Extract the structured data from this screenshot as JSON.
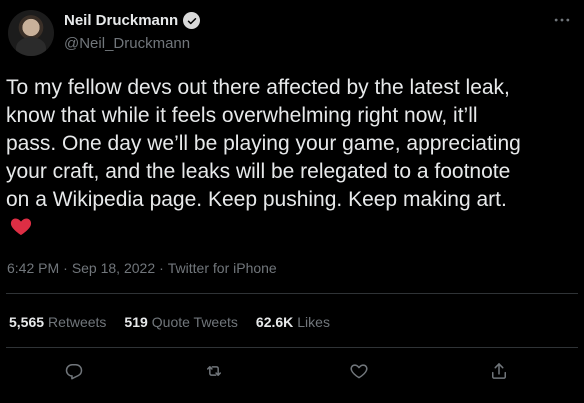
{
  "author": {
    "display_name": "Neil Druckmann",
    "handle": "@Neil_Druckmann",
    "verified": true
  },
  "tweet": {
    "text": "To my fellow devs out there affected by the latest leak,\nknow that while it feels overwhelming right now, it’ll\npass. One day we’ll be playing your game, appreciating\nyour craft, and the leaks will be relegated to a footnote\non a Wikipedia page. Keep pushing. Keep making art.",
    "emoji": "red-heart"
  },
  "meta": {
    "time": "6:42 PM",
    "separator1": "·",
    "date": "Sep 18, 2022",
    "separator2": "·",
    "source": "Twitter for iPhone"
  },
  "stats": {
    "retweets_count": "5,565",
    "retweets_label": "Retweets",
    "quotes_count": "519",
    "quotes_label": "Quote Tweets",
    "likes_count": "62.6K",
    "likes_label": "Likes"
  },
  "colors": {
    "background": "#000000",
    "text": "#e7e9ea",
    "secondary": "#71767b",
    "divider": "#2f3336",
    "heart": "#f91880"
  },
  "icons": {
    "more": "more-horizontal-icon",
    "reply": "reply-icon",
    "retweet": "retweet-icon",
    "like": "like-icon",
    "share": "share-icon"
  }
}
